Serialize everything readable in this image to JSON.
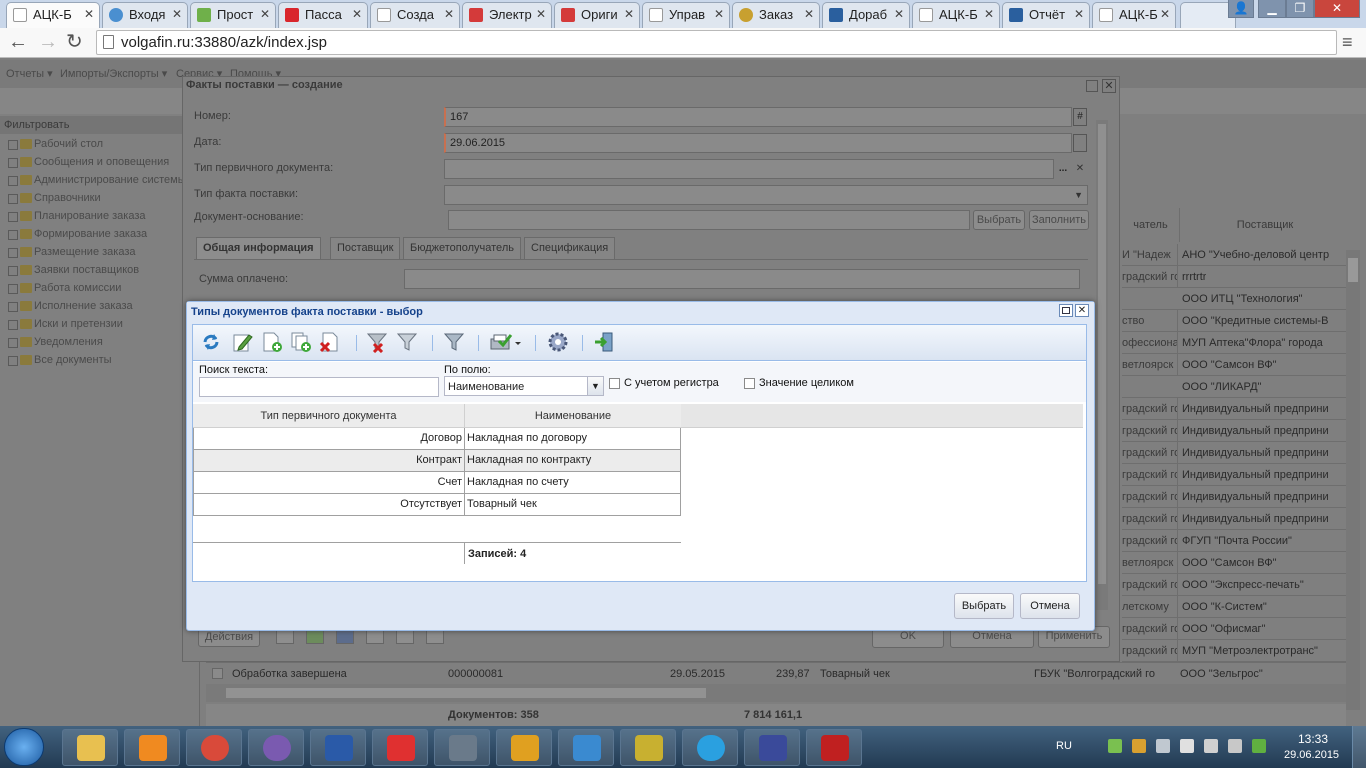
{
  "browser": {
    "tabs": [
      {
        "label": "АЦК-Б",
        "active": true,
        "icon": "page-icon"
      },
      {
        "label": "Входя",
        "icon": "mail-icon"
      },
      {
        "label": "Прост",
        "icon": "blog-icon"
      },
      {
        "label": "Пасса",
        "icon": "rzd-icon"
      },
      {
        "label": "Созда",
        "icon": "page-icon"
      },
      {
        "label": "Электр",
        "icon": "cart-icon"
      },
      {
        "label": "Ориги",
        "icon": "cart-icon"
      },
      {
        "label": "Управ",
        "icon": "page-icon"
      },
      {
        "label": "Заказ",
        "icon": "emblem-icon"
      },
      {
        "label": "Дораб",
        "icon": "jira-icon"
      },
      {
        "label": "АЦК-Б",
        "icon": "page-icon"
      },
      {
        "label": "Отчёт",
        "icon": "jira-icon"
      },
      {
        "label": "АЦК-Б",
        "icon": "page-icon"
      }
    ],
    "url": "volgafin.ru:33880/azk/index.jsp",
    "window_controls": [
      "user-icon",
      "minimize-icon",
      "restore-icon",
      "close-icon"
    ]
  },
  "app": {
    "menu": [
      "Отчеты ▾",
      "Импорты/Экспорты ▾",
      "Сервис ▾",
      "Помощь ▾"
    ],
    "filter_label": "Фильтровать",
    "tree": [
      "Рабочий стол",
      "Сообщения и оповещения",
      "Администрирование системы",
      "Справочники",
      "Планирование заказа",
      "Формирование заказа",
      "Размещение заказа",
      "Заявки поставщиков",
      "Работа комиссии",
      "Исполнение заказа",
      "Иски и претензии",
      "Уведомления",
      "Все документы"
    ],
    "grid_headers": {
      "customer_partial": "чатель",
      "supplier": "Поставщик"
    },
    "grid_rows": [
      {
        "c": "И \"Надеж",
        "s": "АНО \"Учебно-деловой центр"
      },
      {
        "c": "градский го",
        "s": "rrrtrtr"
      },
      {
        "c": "",
        "s": "ООО ИТЦ \"Технология\""
      },
      {
        "c": "ство",
        "s": "ООО \"Кредитные системы-В"
      },
      {
        "c": "офессиона",
        "s": "МУП Аптека\"Флора\" города"
      },
      {
        "c": "ветлоярск",
        "s": "ООО \"Самсон ВФ\""
      },
      {
        "c": "",
        "s": "ООО \"ЛИКАРД\""
      },
      {
        "c": "градский го",
        "s": "Индивидуальный предприни"
      },
      {
        "c": "градский го",
        "s": "Индивидуальный предприни"
      },
      {
        "c": "градский го",
        "s": "Индивидуальный предприни"
      },
      {
        "c": "градский го",
        "s": "Индивидуальный предприни"
      },
      {
        "c": "градский го",
        "s": "Индивидуальный предприни"
      },
      {
        "c": "градский го",
        "s": "Индивидуальный предприни"
      },
      {
        "c": "градский го",
        "s": "ФГУП \"Почта России\""
      },
      {
        "c": "ветлоярск",
        "s": "ООО \"Самсон ВФ\""
      },
      {
        "c": "градский го",
        "s": "ООО \"Экспресс-печать\""
      },
      {
        "c": "летскому",
        "s": "ООО \"К-Систем\""
      },
      {
        "c": "градский го",
        "s": "ООО \"Офисмаг\""
      },
      {
        "c": "градский го",
        "s": "МУП \"Метроэлектротранс\""
      }
    ],
    "last_row": {
      "status": "Обработка завершена",
      "number": "000000081",
      "date": "29.05.2015",
      "amount": "239,87",
      "doc_type": "Товарный чек",
      "customer": "ГБУК \"Волгоградский го",
      "supplier": "ООО \"Зельгрос\""
    },
    "footer": {
      "documents": "Документов: 358",
      "total": "7 814 161,1"
    },
    "action_bar": {
      "actions": "Действия",
      "ok": "OK",
      "cancel": "Отмена",
      "apply": "Применить"
    }
  },
  "outer_dialog": {
    "title": "Факты поставки — создание",
    "number_label": "Номер:",
    "number_value": "167",
    "date_label": "Дата:",
    "date_value": "29.06.2015",
    "primary_doc_type_label": "Тип первичного документа:",
    "supply_fact_type_label": "Тип факта поставки:",
    "base_doc_label": "Документ-основание:",
    "choose_btn": "Выбрать",
    "fill_btn": "Заполнить",
    "tabs": [
      "Общая информация",
      "Поставщик",
      "Бюджетополучатель",
      "Спецификация"
    ],
    "sum_paid_label": "Сумма оплачено:",
    "ellipsis": "..."
  },
  "inner_dialog": {
    "title": "Типы документов факта поставки - выбор",
    "toolbar_icons": [
      "refresh-icon",
      "edit-icon",
      "add-icon",
      "copy-add-icon",
      "delete-icon",
      "filter-clear-icon",
      "filter-icon",
      "funnel-icon",
      "print-approve-icon",
      "settings-icon",
      "exit-icon"
    ],
    "search_label": "Поиск текста:",
    "search_value": "",
    "field_label": "По полю:",
    "field_value": "Наименование",
    "case_label": "С учетом регистра",
    "whole_label": "Значение целиком",
    "columns": [
      "Тип первичного документа",
      "Наименование"
    ],
    "rows": [
      {
        "type": "Договор",
        "name": "Накладная по договору"
      },
      {
        "type": "Контракт",
        "name": "Накладная по контракту"
      },
      {
        "type": "Счет",
        "name": "Накладная по счету"
      },
      {
        "type": "Отсутствует",
        "name": "Товарный чек"
      }
    ],
    "records": "Записей: 4",
    "select_btn": "Выбрать",
    "cancel_btn": "Отмена"
  },
  "taskbar": {
    "apps": [
      "explorer-icon",
      "media-player-icon",
      "chrome-icon",
      "viber-icon",
      "word-icon",
      "yandex-icon",
      "calculator-icon",
      "outlook-icon",
      "lync-icon",
      "game-icon",
      "skype-icon",
      "save-icon",
      "pdf-icon"
    ],
    "lang": "RU",
    "time": "13:33",
    "date": "29.06.2015"
  }
}
